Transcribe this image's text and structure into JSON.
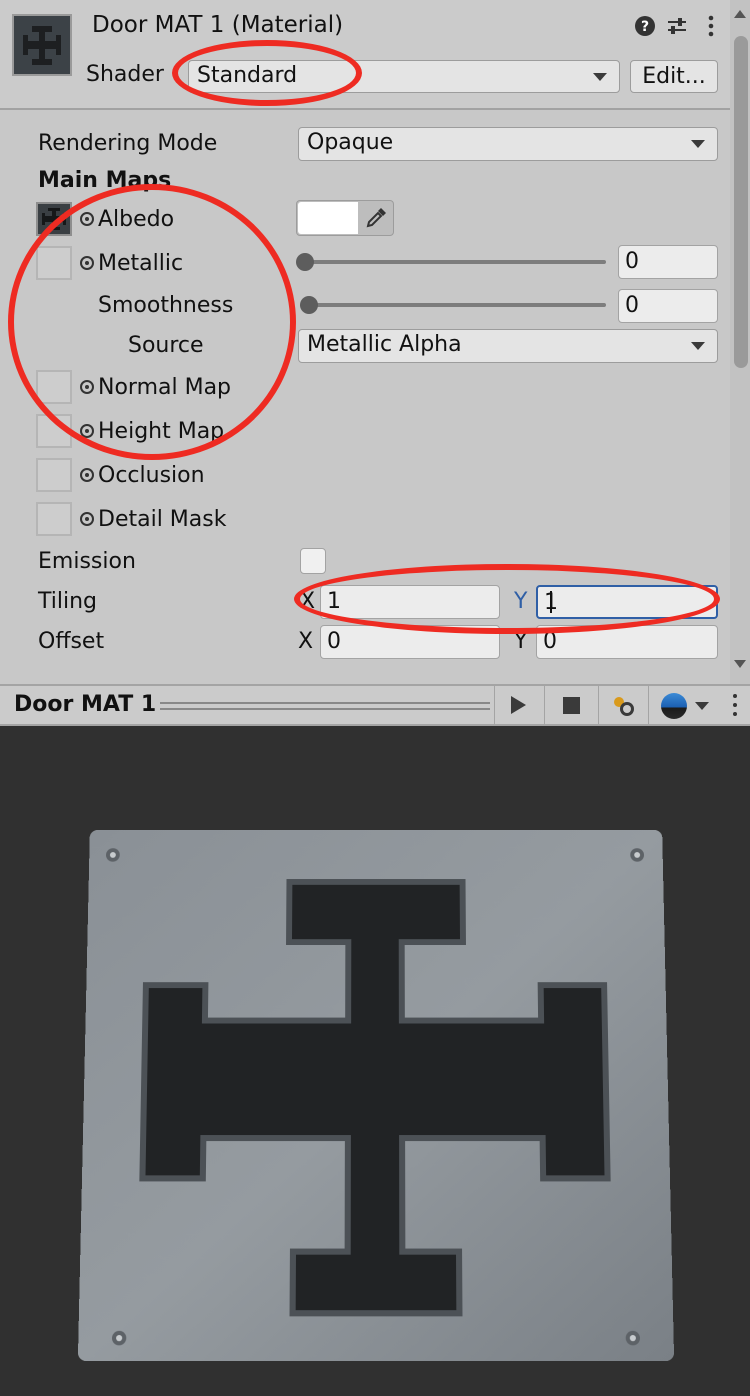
{
  "header": {
    "title": "Door MAT 1 (Material)",
    "shader_label": "Shader",
    "shader_value": "Standard",
    "edit_label": "Edit...",
    "icons": [
      "help-icon",
      "preset-sliders-icon",
      "more-options-icon"
    ]
  },
  "properties": {
    "rendering_mode_label": "Rendering Mode",
    "rendering_mode_value": "Opaque",
    "main_maps_label": "Main Maps",
    "albedo_label": "Albedo",
    "albedo_color": "#ffffff",
    "metallic_label": "Metallic",
    "metallic_value": "0",
    "smoothness_label": "Smoothness",
    "smoothness_value": "0",
    "source_label": "Source",
    "source_value": "Metallic Alpha",
    "normal_map_label": "Normal Map",
    "height_map_label": "Height Map",
    "occlusion_label": "Occlusion",
    "detail_mask_label": "Detail Mask",
    "emission_label": "Emission",
    "tiling_label": "Tiling",
    "tiling_x_axis": "X",
    "tiling_x": "1",
    "tiling_y_axis": "Y",
    "tiling_y": "1",
    "offset_label": "Offset",
    "offset_x_axis": "X",
    "offset_x": "0",
    "offset_y_axis": "Y",
    "offset_y": "0"
  },
  "preview": {
    "title": "Door MAT 1"
  },
  "colors": {
    "annotation": "#ee2b22",
    "active_field": "#2f5fa6"
  }
}
